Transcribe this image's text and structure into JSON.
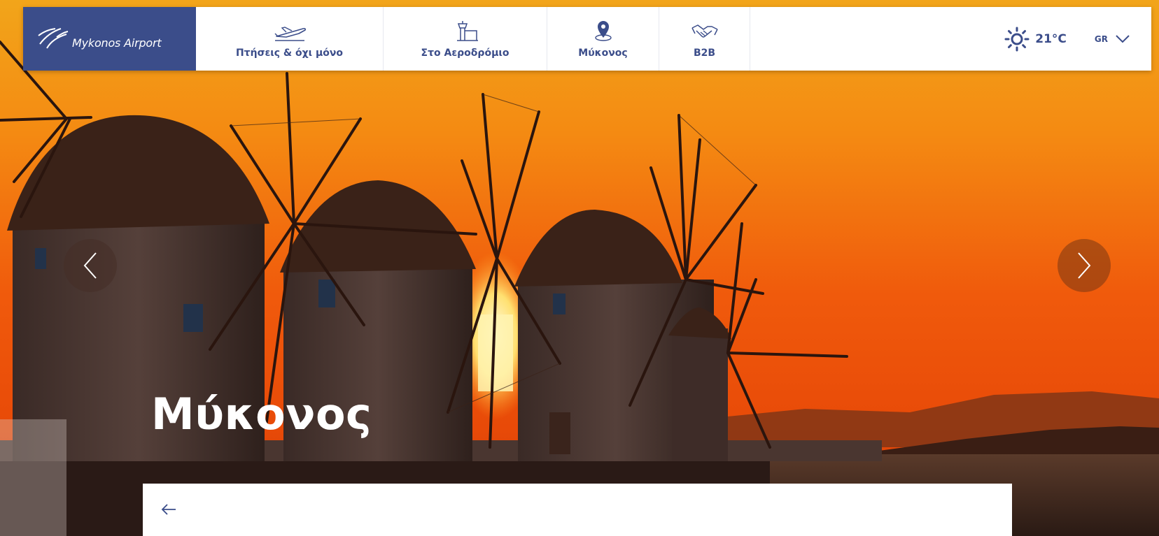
{
  "brand": {
    "logo_text": "Mykonos Airport",
    "logo_bg": "#3b4d8a",
    "accent": "#3b4d8a"
  },
  "nav": {
    "items": [
      {
        "label": "Πτήσεις & όχι μόνο",
        "icon": "airplane-takeoff-icon"
      },
      {
        "label": "Στο Αεροδρόμιο",
        "icon": "control-tower-icon"
      },
      {
        "label": "Μύκονος",
        "icon": "map-pin-icon"
      },
      {
        "label": "B2B",
        "icon": "handshake-icon"
      }
    ]
  },
  "weather": {
    "icon": "sun-icon",
    "temperature": "21°C"
  },
  "language": {
    "selected": "GR",
    "icon": "chevron-down-icon"
  },
  "carousel": {
    "prev_icon": "chevron-left-icon",
    "next_icon": "chevron-right-icon"
  },
  "hero": {
    "title": "Μύκονος"
  },
  "card": {
    "back_icon": "arrow-left-icon"
  }
}
